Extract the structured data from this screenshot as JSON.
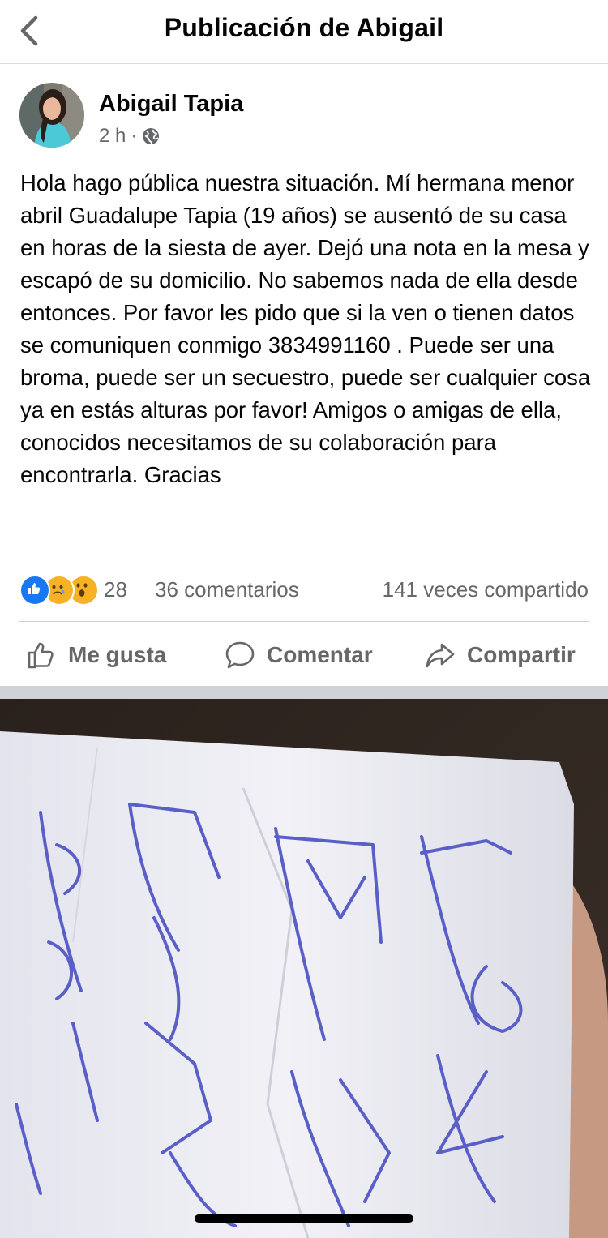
{
  "header": {
    "title": "Publicación de Abigail",
    "back_icon": "chevron-left-icon"
  },
  "post": {
    "author": "Abigail Tapia",
    "time": "2 h",
    "separator": "·",
    "audience_icon": "globe-icon",
    "body": "Hola hago pública nuestra situación. Mí hermana menor abril Guadalupe Tapia (19 años) se ausentó de su casa en horas de la siesta de ayer. Dejó una nota en la mesa y escapó de su domicilio. No sabemos nada de ella desde entonces. Por favor les pido que si la ven o tienen datos se comuniquen conmigo 3834991160 . Puede ser una broma, puede ser un secuestro, puede ser cualquier cosa ya en estás alturas por favor! Amigos o amigas de ella, conocidos necesitamos de su colaboración para encontrarla. Gracias"
  },
  "stats": {
    "reaction_icons": [
      "like-icon",
      "sad-icon",
      "wow-icon"
    ],
    "reaction_count": "28",
    "comments": "36 comentarios",
    "shares": "141 veces compartido"
  },
  "actions": {
    "like": "Me gusta",
    "comment": "Comentar",
    "share": "Compartir"
  },
  "colors": {
    "like_blue": "#1877f2",
    "reaction_yellow": "#f7b125",
    "muted_text": "#65676b",
    "ink_blue": "#5a5fc8"
  }
}
